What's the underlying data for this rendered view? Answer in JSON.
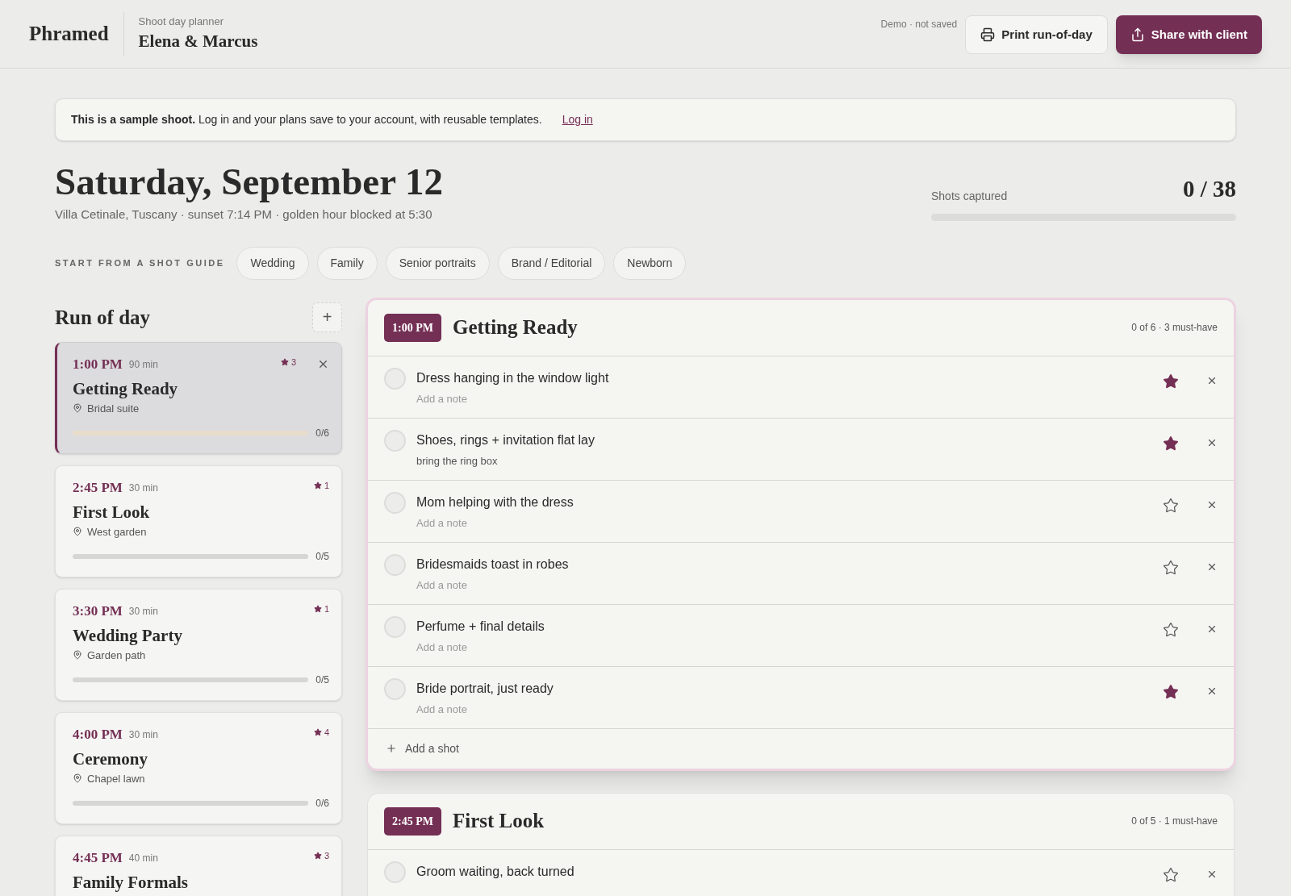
{
  "header": {
    "brand": "Phramed",
    "subtitle": "Shoot day planner",
    "title": "Elena & Marcus",
    "status": "Demo · not saved",
    "buttons": [
      {
        "kind": "print",
        "label": "Print run-of-day"
      },
      {
        "kind": "share",
        "label": "Share with client"
      }
    ]
  },
  "notice": {
    "text": "**This is a sample shoot.** Log in and your plans save to your account, with reusable templates.",
    "link": "Log in"
  },
  "day": {
    "title": "Saturday, September 12",
    "details": "Villa Cetinale, Tuscany · sunset 7:14 PM · golden hour blocked at 5:30"
  },
  "progress": {
    "label": "Shots captured",
    "count": "0 / 38",
    "level": 0
  },
  "guides": {
    "label": "START FROM A SHOT GUIDE",
    "chips": [
      "Wedding",
      "Family",
      "Senior portraits",
      "Brand / Editorial",
      "Newborn"
    ]
  },
  "run_of_day": {
    "title": "Run of day",
    "add": "+",
    "items": [
      {
        "time": "1:00 PM",
        "duration": "90 min",
        "stars": "3",
        "title": "Getting Ready",
        "location": "Bridal suite",
        "count": "0/6",
        "level": 0,
        "selected": true
      },
      {
        "time": "2:45 PM",
        "duration": "30 min",
        "stars": "1",
        "title": "First Look",
        "location": "West garden",
        "count": "0/5",
        "level": 0,
        "selected": false
      },
      {
        "time": "3:30 PM",
        "duration": "30 min",
        "stars": "1",
        "title": "Wedding Party",
        "location": "Garden path",
        "count": "0/5",
        "level": 0,
        "selected": false
      },
      {
        "time": "4:00 PM",
        "duration": "30 min",
        "stars": "4",
        "title": "Ceremony",
        "location": "Chapel lawn",
        "count": "0/6",
        "level": 0,
        "selected": false
      },
      {
        "time": "4:45 PM",
        "duration": "40 min",
        "stars": "3",
        "title": "Family Formals",
        "selected": false
      }
    ]
  },
  "sections": [
    {
      "time": "1:00 PM",
      "title": "Getting Ready",
      "summary": "0 of 6 · 3 must-have",
      "selected": true,
      "add": "Add a shot",
      "shots": [
        {
          "title": "Dress hanging in the window light",
          "placeholder": "Add a note",
          "checked": false,
          "must_have": true
        },
        {
          "title": "Shoes, rings + invitation flat lay",
          "note": "bring the ring box",
          "checked": false,
          "must_have": true
        },
        {
          "title": "Mom helping with the dress",
          "placeholder": "Add a note",
          "checked": false,
          "must_have": false
        },
        {
          "title": "Bridesmaids toast in robes",
          "placeholder": "Add a note",
          "checked": false,
          "must_have": false
        },
        {
          "title": "Perfume + final details",
          "placeholder": "Add a note",
          "checked": false,
          "must_have": false
        },
        {
          "title": "Bride portrait, just ready",
          "placeholder": "Add a note",
          "checked": false,
          "must_have": true
        }
      ]
    },
    {
      "time": "2:45 PM",
      "title": "First Look",
      "summary": "0 of 5 · 1 must-have",
      "selected": false,
      "shots": [
        {
          "title": "Groom waiting, back turned",
          "checked": false,
          "must_have": false
        }
      ]
    }
  ]
}
